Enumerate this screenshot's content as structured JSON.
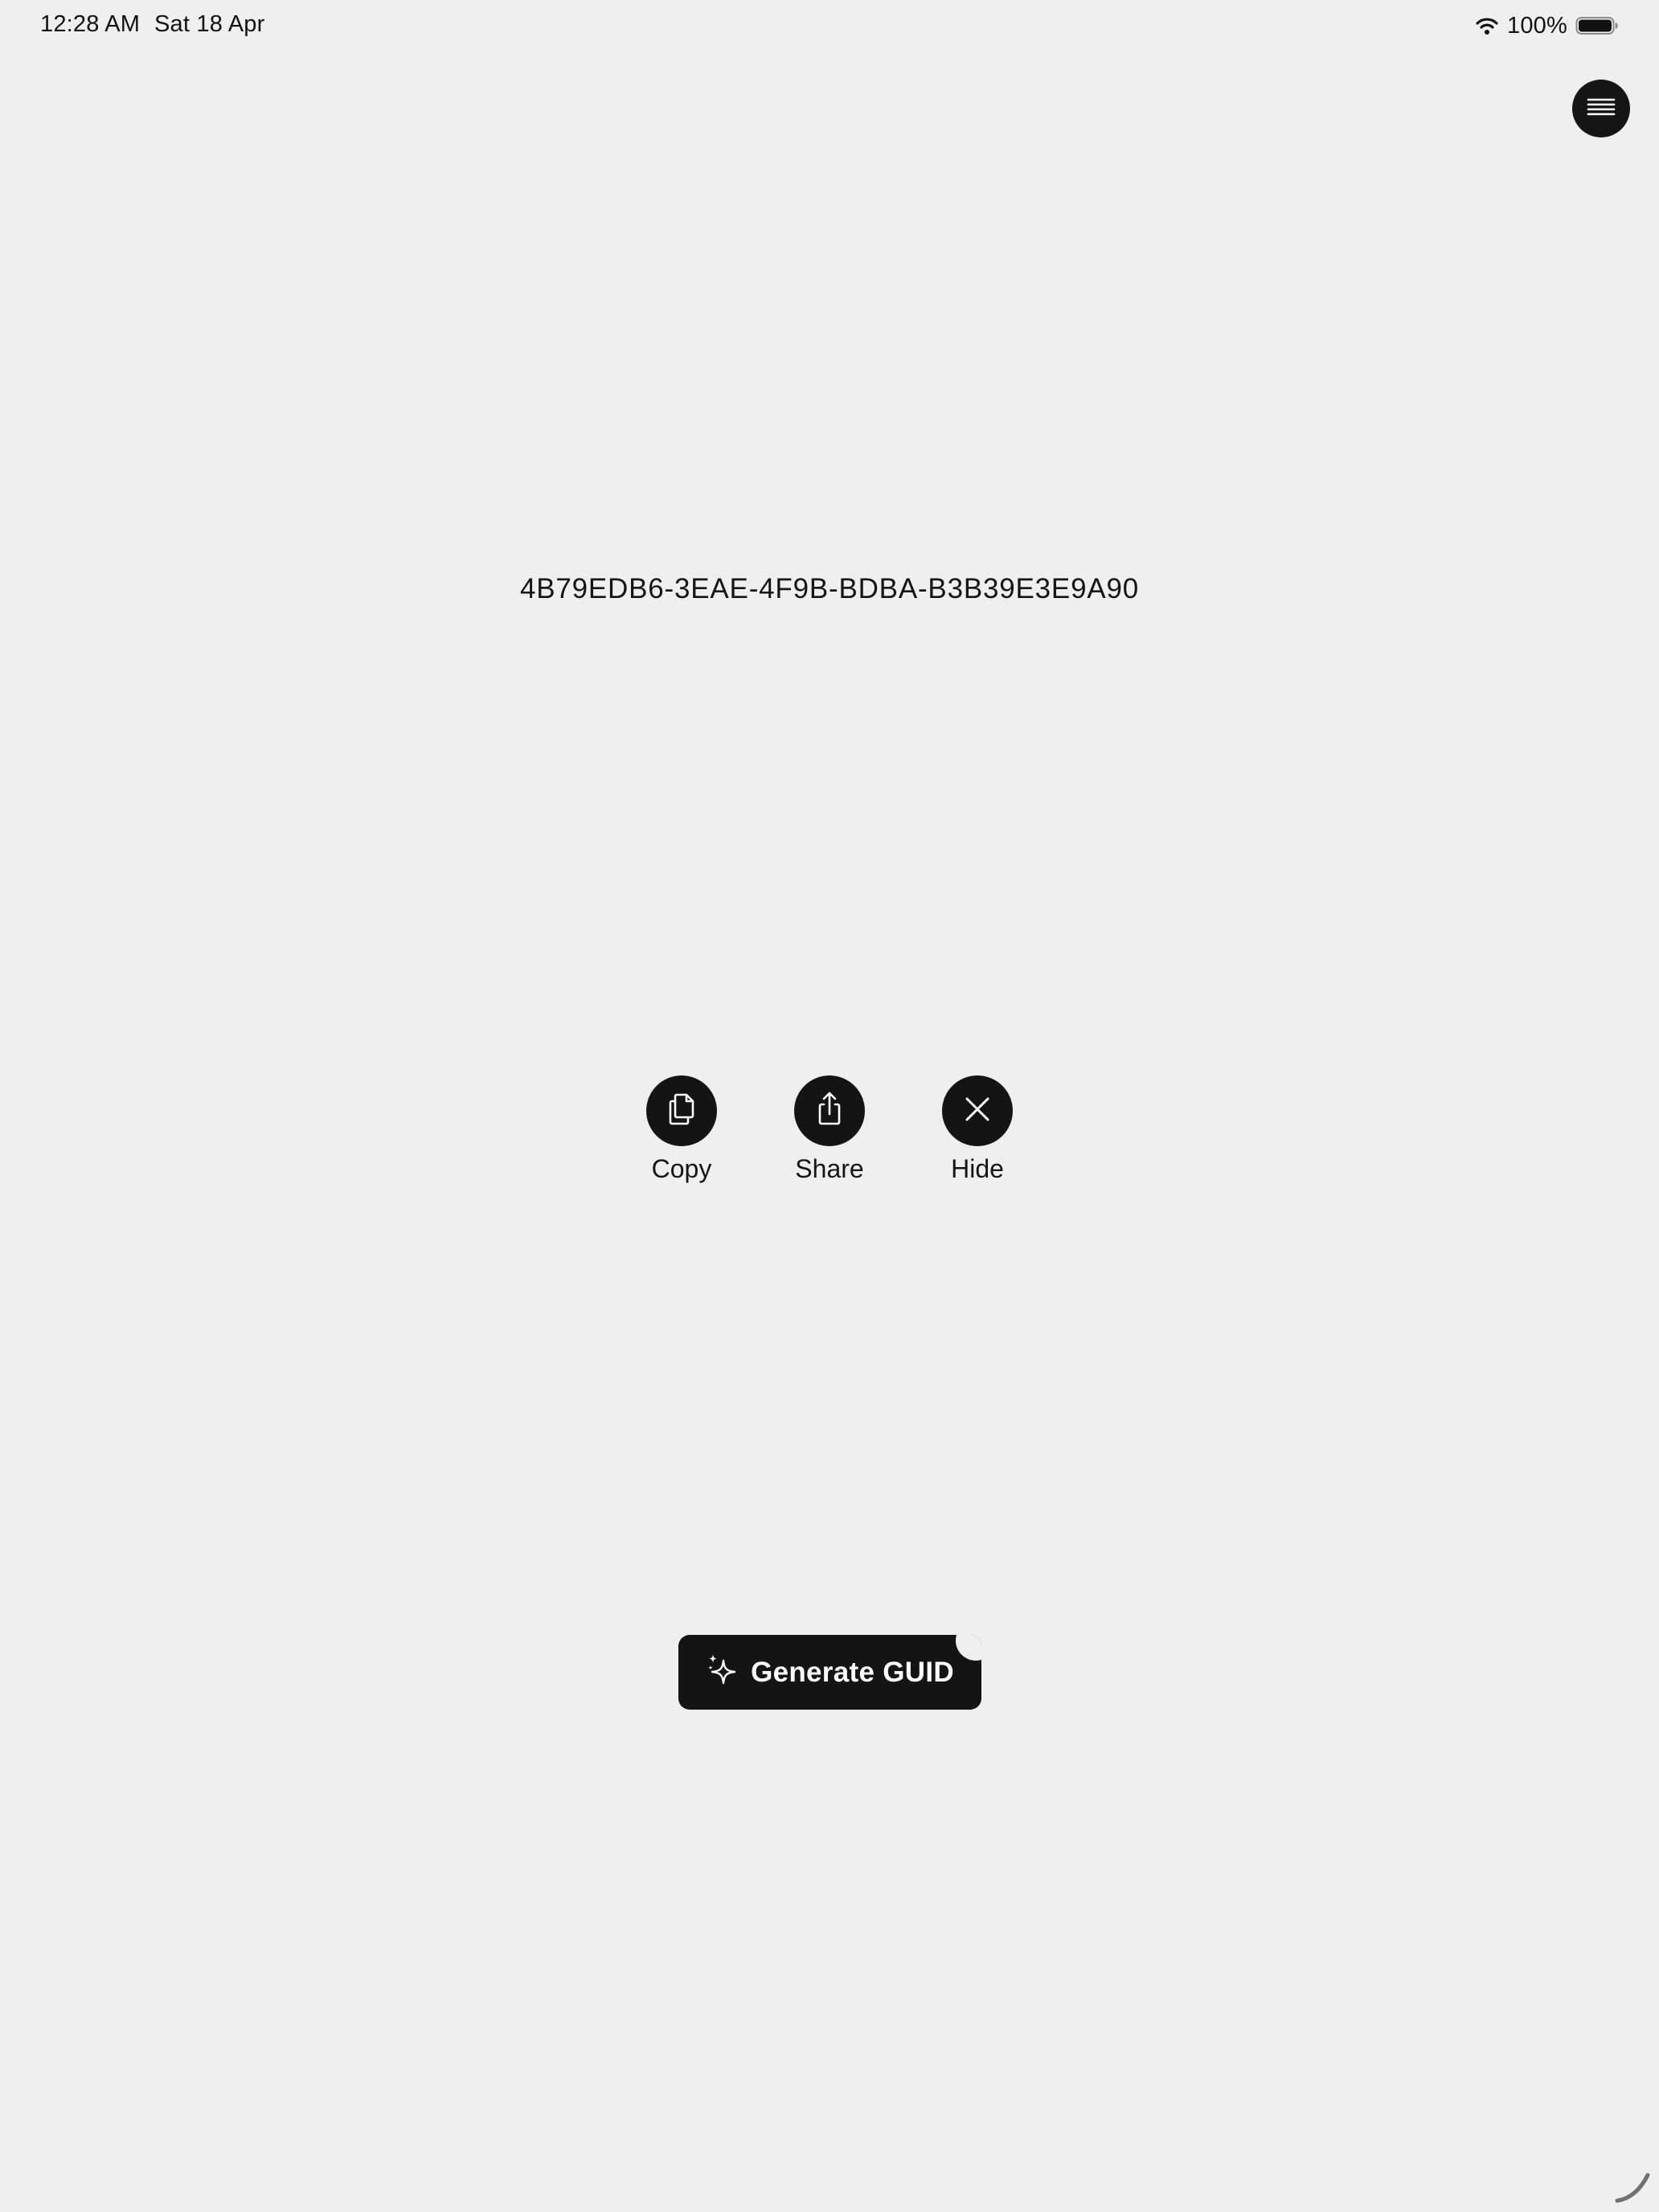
{
  "status_bar": {
    "time": "12:28 AM",
    "date": "Sat 18 Apr",
    "battery_percent": "100%",
    "icons": [
      "wifi-icon",
      "battery-icon"
    ]
  },
  "header": {
    "menu_icon": "hamburger-menu-icon"
  },
  "main": {
    "guid": "4B79EDB6-3EAE-4F9B-BDBA-B3B39E3E9A90"
  },
  "actions": [
    {
      "label": "Copy",
      "icon": "copy-icon"
    },
    {
      "label": "Share",
      "icon": "share-icon"
    },
    {
      "label": "Hide",
      "icon": "close-icon"
    }
  ],
  "generate_button": {
    "label": "Generate GUID",
    "icon": "sparkles-icon"
  },
  "colors": {
    "background": "#efefef",
    "button": "#141414",
    "text": "#151515",
    "button_text": "#ffffff"
  }
}
